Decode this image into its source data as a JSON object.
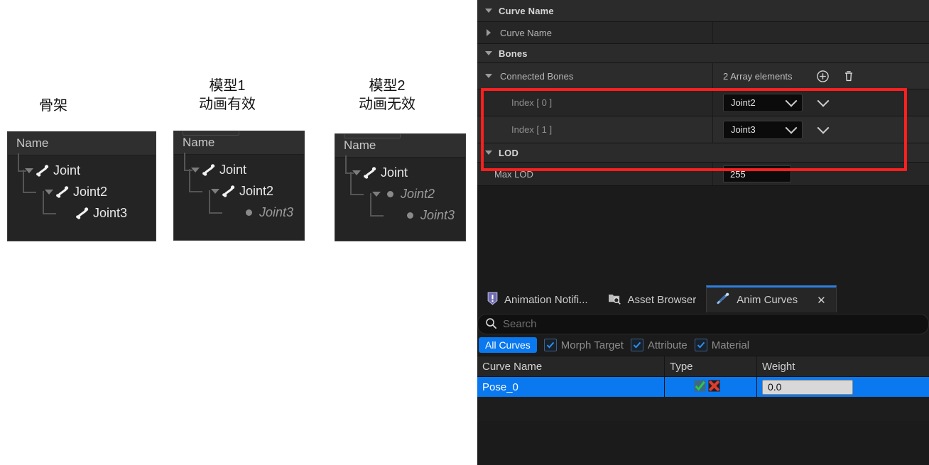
{
  "diagram": {
    "captions": [
      {
        "lines": [
          "骨架"
        ]
      },
      {
        "lines": [
          "模型1",
          "动画有效"
        ]
      },
      {
        "lines": [
          "模型2",
          "动画无效"
        ]
      }
    ],
    "panels": [
      {
        "header": "Name",
        "nodes": [
          {
            "label": "Joint",
            "icon": "bone-icon",
            "twisty": "down",
            "depth": 0,
            "dim": false
          },
          {
            "label": "Joint2",
            "icon": "bone-icon",
            "twisty": "down",
            "depth": 1,
            "dim": false
          },
          {
            "label": "Joint3",
            "icon": "bone-icon",
            "twisty": "none",
            "depth": 2,
            "dim": false
          }
        ]
      },
      {
        "header": "Name",
        "nodes": [
          {
            "label": "Joint",
            "icon": "bone-icon",
            "twisty": "down",
            "depth": 0,
            "dim": false
          },
          {
            "label": "Joint2",
            "icon": "bone-icon",
            "twisty": "down",
            "depth": 1,
            "dim": false
          },
          {
            "label": "Joint3",
            "icon": "dot-icon",
            "twisty": "none",
            "depth": 2,
            "dim": true
          }
        ]
      },
      {
        "header": "Name",
        "nodes": [
          {
            "label": "Joint",
            "icon": "bone-icon",
            "twisty": "down",
            "depth": 0,
            "dim": false
          },
          {
            "label": "Joint2",
            "icon": "dot-icon",
            "twisty": "down",
            "depth": 1,
            "dim": true
          },
          {
            "label": "Joint3",
            "icon": "dot-icon",
            "twisty": "none",
            "depth": 2,
            "dim": true
          }
        ]
      }
    ]
  },
  "details": {
    "categories": {
      "curve_name": "Curve Name",
      "bones": "Bones",
      "lod": "LOD"
    },
    "rows": {
      "curve_name_prop": "Curve Name",
      "connected_bones": "Connected Bones",
      "connected_bones_count": "2 Array elements",
      "index0": "Index [ 0 ]",
      "index1": "Index [ 1 ]",
      "index0_value": "Joint2",
      "index1_value": "Joint3",
      "max_lod": "Max LOD",
      "max_lod_value": "255"
    },
    "highlight_color": "#ff1f1f"
  },
  "bottom": {
    "tabs": [
      {
        "label": "Animation Notifi...",
        "icon": "notify-icon",
        "active": false
      },
      {
        "label": "Asset Browser",
        "icon": "asset-browser-icon",
        "active": false
      },
      {
        "label": "Anim Curves",
        "icon": "anim-curves-icon",
        "active": true,
        "close": "✕"
      }
    ],
    "search": {
      "placeholder": "Search",
      "value": ""
    },
    "filters": {
      "all_curves": "All Curves",
      "items": [
        {
          "label": "Morph Target",
          "checked": true
        },
        {
          "label": "Attribute",
          "checked": true
        },
        {
          "label": "Material",
          "checked": true
        }
      ]
    },
    "table": {
      "columns": [
        "Curve Name",
        "Type",
        "Weight"
      ],
      "rows": [
        {
          "name": "Pose_0",
          "weight": "0.0",
          "selected": true
        }
      ]
    },
    "accent_color": "#0a78ef"
  }
}
